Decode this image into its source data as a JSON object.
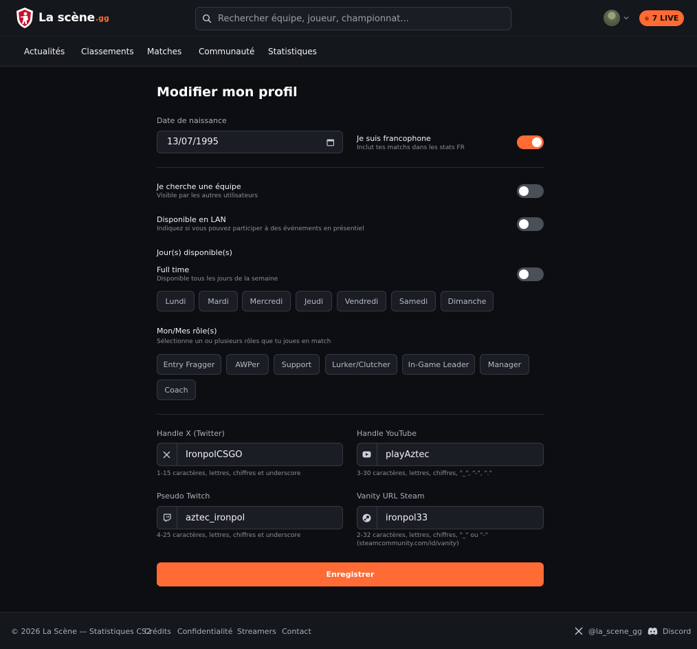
{
  "brand": {
    "name": "La scène",
    "suffix": ".gg",
    "accent": "#ff6b35"
  },
  "header": {
    "search_placeholder": "Rechercher équipe, joueur, championnat...",
    "live_label": "7 LIVE"
  },
  "nav": [
    "Actualités",
    "Classements",
    "Matches",
    "Communauté",
    "Statistiques"
  ],
  "form": {
    "title": "Modifier mon profil",
    "birthdate_label": "Date de naissance",
    "birthdate_value": "13/07/1995",
    "francophone": {
      "title": "Je suis francophone",
      "subtitle": "Inclut tes matchs dans les stats FR",
      "on": true
    },
    "team_search": {
      "title": "Je cherche une équipe",
      "subtitle": "Visible par les autres utilisateurs",
      "on": false
    },
    "lan": {
      "title": "Disponible en LAN",
      "subtitle": "Indiquez si vous pouvez participer à des événements en présentiel",
      "on": false
    },
    "days_title": "Jour(s) disponible(s)",
    "fulltime": {
      "title": "Full time",
      "subtitle": "Disponible tous les jours de la semaine",
      "on": false
    },
    "days": [
      "Lundi",
      "Mardi",
      "Mercredi",
      "Jeudi",
      "Vendredi",
      "Samedi",
      "Dimanche"
    ],
    "roles_title": "Mon/Mes rôle(s)",
    "roles_subtitle": "Sélectionne un ou plusieurs rôles que tu joues en match",
    "roles": [
      "Entry Fragger",
      "AWPer",
      "Support",
      "Lurker/Clutcher",
      "In-Game Leader",
      "Manager",
      "Coach"
    ],
    "twitter": {
      "label": "Handle X (Twitter)",
      "value": "IronpolCSGO",
      "hint": "1-15 caractères, lettres, chiffres et underscore"
    },
    "youtube": {
      "label": "Handle YouTube",
      "value": "playAztec",
      "hint": "3-30 caractères, lettres, chiffres, \"_\", \"-\", \".\""
    },
    "twitch": {
      "label": "Pseudo Twitch",
      "value": "aztec_ironpol",
      "hint": "4-25 caractères, lettres, chiffres et underscore"
    },
    "steam": {
      "label": "Vanity URL Steam",
      "value": "ironpol33",
      "hint_line1": "2-32 caractères, lettres, chiffres, \"_\" ou \"-\"",
      "hint_line2_prefix": "(steamcommunity.com/id/",
      "hint_line2_italic": "vanity",
      "hint_line2_suffix": ")"
    },
    "save_label": "Enregistrer"
  },
  "footer": {
    "copyright": "© 2026 La Scène — Statistiques CS2",
    "links": [
      "Crédits",
      "Confidentialité",
      "Streamers",
      "Contact"
    ],
    "x_handle": "@la_scene_gg",
    "discord": "Discord"
  }
}
